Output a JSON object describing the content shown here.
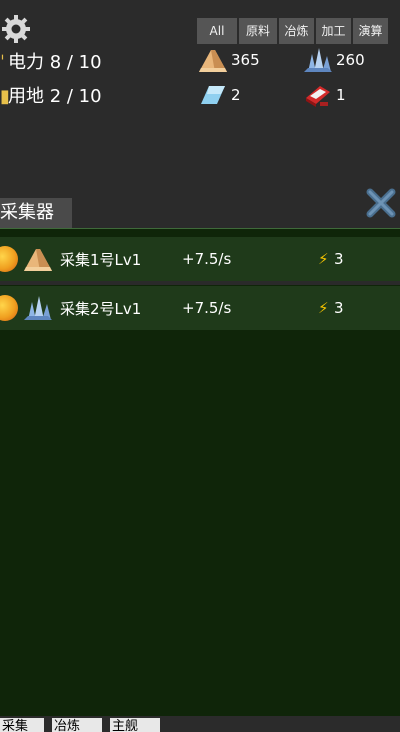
{
  "header": {
    "power_label": "电力 8 / 10",
    "land_label": "用地 2 / 10"
  },
  "filters": [
    "All",
    "原料",
    "冶炼",
    "加工",
    "演算"
  ],
  "resources": [
    {
      "icon": "wood-icon",
      "count": "365"
    },
    {
      "icon": "crystal-icon",
      "count": "260"
    },
    {
      "icon": "blue-gem-icon",
      "count": "2"
    },
    {
      "icon": "red-ingot-icon",
      "count": "1"
    }
  ],
  "panel_title": "采集器",
  "collectors": [
    {
      "name": "采集1号Lv1",
      "rate": "+7.5/s",
      "bolt": "⚡",
      "power": "3",
      "icon": "wood-icon"
    },
    {
      "name": "采集2号Lv1",
      "rate": "+7.5/s",
      "bolt": "⚡",
      "power": "3",
      "icon": "crystal-icon"
    }
  ],
  "bottom_tabs": [
    "采集",
    "冶炼",
    "主舰"
  ],
  "colors": {
    "panel_bg": "#0f2509",
    "row_bg": "#1f3a1a",
    "bolt": "#f2c200"
  }
}
